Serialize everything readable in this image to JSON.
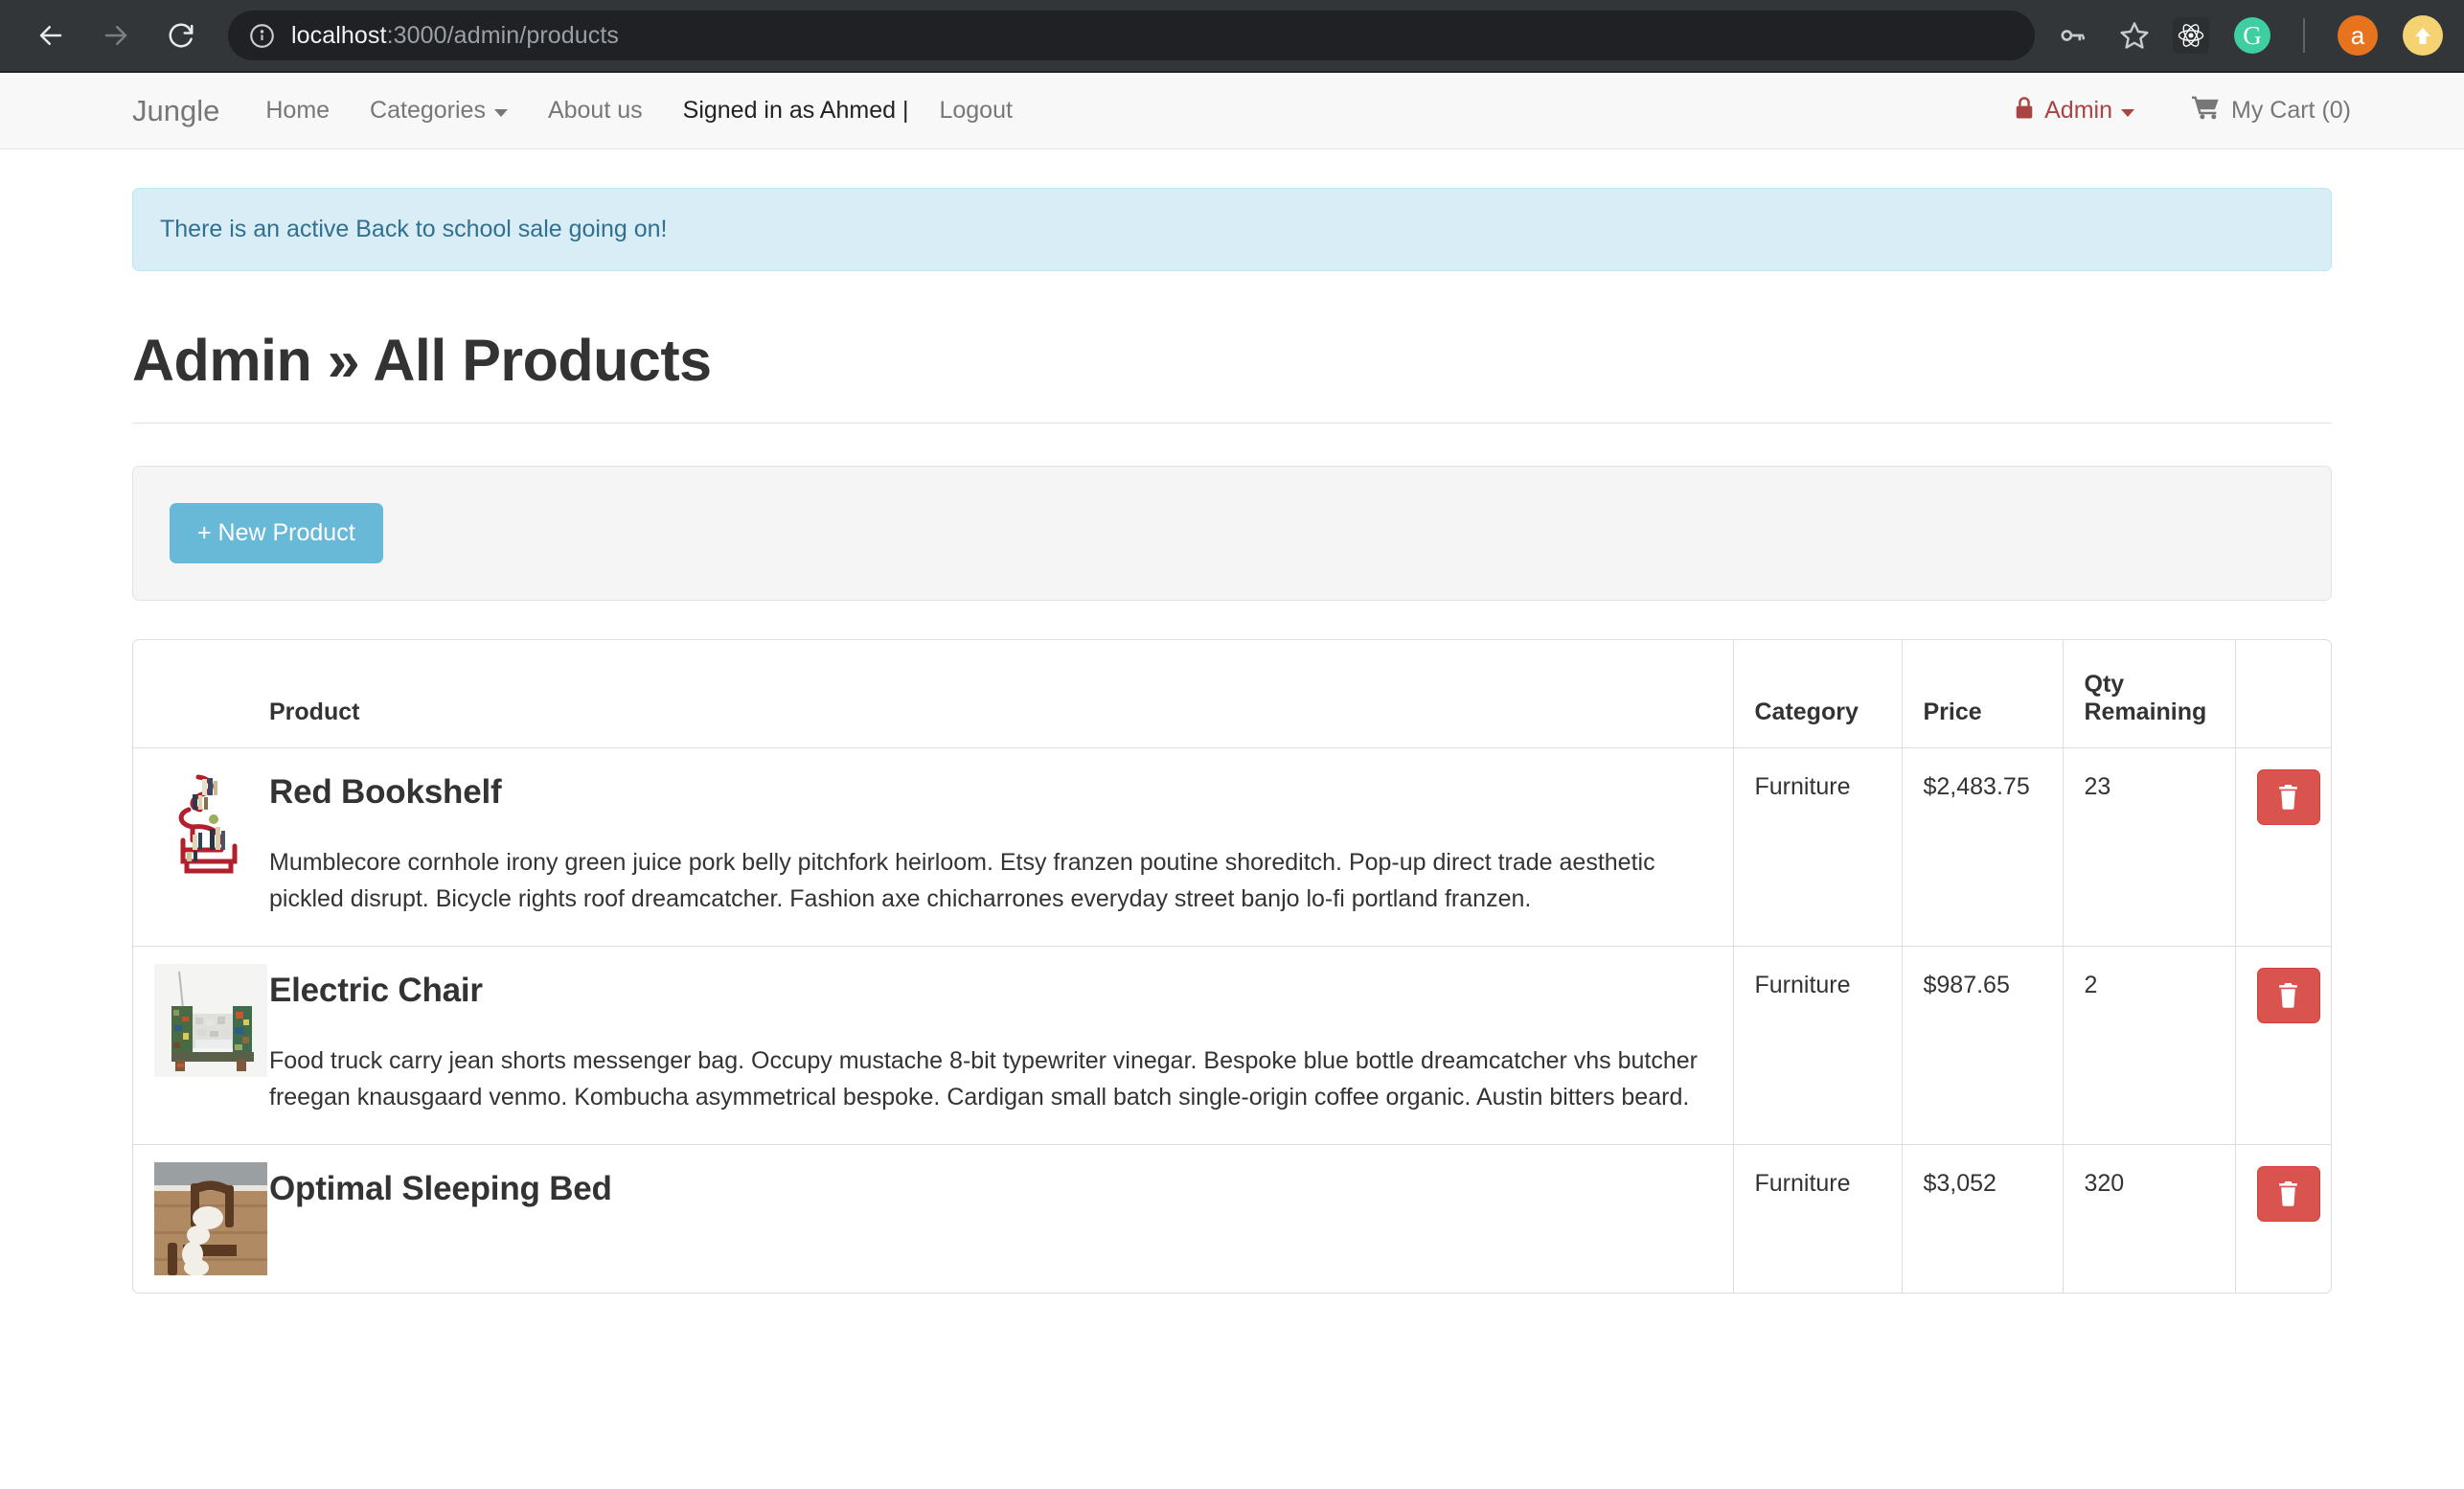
{
  "browser": {
    "url_host": "localhost",
    "url_path": ":3000/admin/products",
    "icons": {
      "back": "back-arrow-icon",
      "forward": "forward-arrow-icon",
      "reload": "reload-icon",
      "info": "info-circle-icon",
      "password": "key-icon",
      "bookmark": "star-icon",
      "react_devtools": "react-icon",
      "grammarly": "grammarly-icon",
      "profile": "profile-avatar-icon",
      "update": "update-arrow-icon"
    },
    "grammarly_letter": "G",
    "profile_letter": "a"
  },
  "navbar": {
    "brand": "Jungle",
    "links": [
      {
        "label": "Home",
        "style": "muted"
      },
      {
        "label": "Categories",
        "style": "muted",
        "caret": true
      },
      {
        "label": "About us",
        "style": "muted"
      },
      {
        "label": "Signed in as Ahmed |",
        "style": "dark"
      },
      {
        "label": "Logout",
        "style": "muted"
      }
    ],
    "admin": {
      "label": "Admin",
      "icon": "lock-icon",
      "color": "#a94442"
    },
    "cart": {
      "label": "My Cart (0)",
      "icon": "shopping-cart-icon"
    }
  },
  "alert": {
    "message": "There is an active Back to school sale going on!",
    "bg": "#d9edf7",
    "text_color": "#31708f"
  },
  "page": {
    "title": "Admin » All Products"
  },
  "toolbar": {
    "new_product_label": "+ New Product",
    "new_product_color": "#68b9d8"
  },
  "table": {
    "headers": {
      "thumb": "",
      "product": "Product",
      "category": "Category",
      "price": "Price",
      "qty": "Qty Remaining",
      "action": ""
    },
    "delete_icon": "trash-icon",
    "delete_color": "#d9534f",
    "rows": [
      {
        "name": "Red Bookshelf",
        "description": "Mumblecore cornhole irony green juice pork belly pitchfork heirloom. Etsy franzen poutine shoreditch. Pop-up direct trade aesthetic pickled disrupt. Bicycle rights roof dreamcatcher. Fashion axe chicharrones everyday street banjo lo-fi portland franzen.",
        "category": "Furniture",
        "price": "$2,483.75",
        "qty": "23",
        "thumb_alt": "red-bookshelf-thumbnail"
      },
      {
        "name": "Electric Chair",
        "description": "Food truck carry jean shorts messenger bag. Occupy mustache 8-bit typewriter vinegar. Bespoke blue bottle dreamcatcher vhs butcher freegan knausgaard venmo. Kombucha asymmetrical bespoke. Cardigan small batch single-origin coffee organic. Austin bitters beard.",
        "category": "Furniture",
        "price": "$987.65",
        "qty": "2",
        "thumb_alt": "electric-chair-thumbnail"
      },
      {
        "name": "Optimal Sleeping Bed",
        "description": "",
        "category": "Furniture",
        "price": "$3,052",
        "qty": "320",
        "thumb_alt": "optimal-sleeping-bed-thumbnail"
      }
    ]
  }
}
